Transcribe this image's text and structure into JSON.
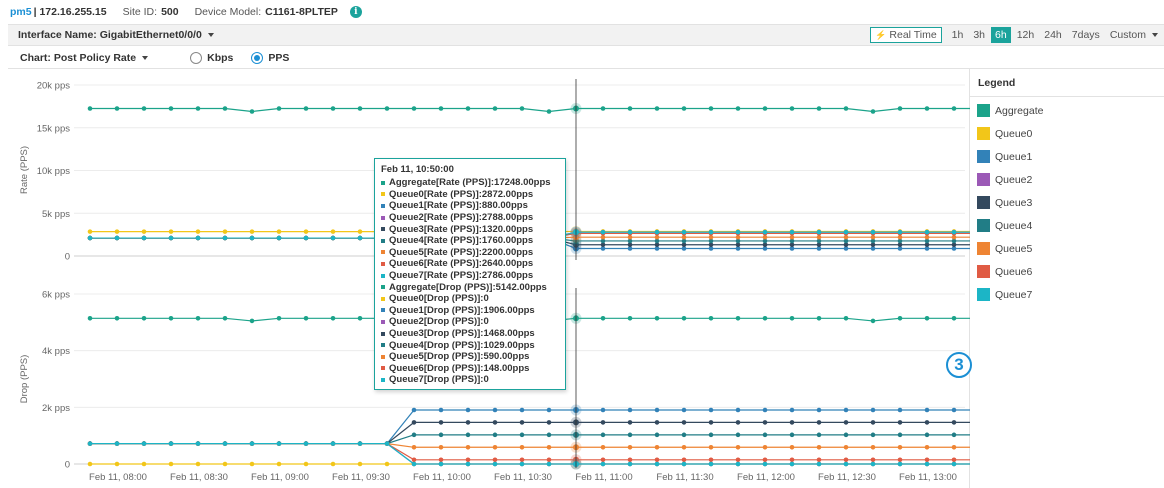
{
  "header": {
    "device_name": "pm5",
    "separator": "|",
    "ip": "172.16.255.15",
    "site_label": "Site ID:",
    "site_id": "500",
    "model_label": "Device Model:",
    "model": "C1161-8PLTEP",
    "info_icon": "info-icon",
    "info_glyph": "i"
  },
  "interface": {
    "label": "Interface Name: GigabitEthernet0/0/0"
  },
  "time_range": {
    "realtime_label": "Real Time",
    "options": [
      "1h",
      "3h",
      "6h",
      "12h",
      "24h",
      "7days"
    ],
    "active": "6h",
    "custom_label": "Custom"
  },
  "chart_selector": {
    "label": "Chart: Post Policy Rate",
    "unit_options": [
      "Kbps",
      "PPS"
    ],
    "selected_unit": "PPS"
  },
  "legend": {
    "title": "Legend",
    "items": [
      {
        "name": "Aggregate",
        "color": "#1ba38a"
      },
      {
        "name": "Queue0",
        "color": "#f2c619"
      },
      {
        "name": "Queue1",
        "color": "#3282b8"
      },
      {
        "name": "Queue2",
        "color": "#9b59b6"
      },
      {
        "name": "Queue3",
        "color": "#34495e"
      },
      {
        "name": "Queue4",
        "color": "#217d86"
      },
      {
        "name": "Queue5",
        "color": "#ee8433"
      },
      {
        "name": "Queue6",
        "color": "#e05b44"
      },
      {
        "name": "Queue7",
        "color": "#1cb5c6"
      }
    ]
  },
  "tooltip": {
    "time": "Feb 11, 10:50:00",
    "rows": [
      {
        "text": "Aggregate[Rate (PPS)]:17248.00pps",
        "color": "#1ba38a"
      },
      {
        "text": "Queue0[Rate (PPS)]:2872.00pps",
        "color": "#f2c619"
      },
      {
        "text": "Queue1[Rate (PPS)]:880.00pps",
        "color": "#3282b8"
      },
      {
        "text": "Queue2[Rate (PPS)]:2788.00pps",
        "color": "#9b59b6"
      },
      {
        "text": "Queue3[Rate (PPS)]:1320.00pps",
        "color": "#34495e"
      },
      {
        "text": "Queue4[Rate (PPS)]:1760.00pps",
        "color": "#217d86"
      },
      {
        "text": "Queue5[Rate (PPS)]:2200.00pps",
        "color": "#ee8433"
      },
      {
        "text": "Queue6[Rate (PPS)]:2640.00pps",
        "color": "#e05b44"
      },
      {
        "text": "Queue7[Rate (PPS)]:2786.00pps",
        "color": "#1cb5c6"
      },
      {
        "text": "Aggregate[Drop (PPS)]:5142.00pps",
        "color": "#1ba38a"
      },
      {
        "text": "Queue0[Drop (PPS)]:0",
        "color": "#f2c619"
      },
      {
        "text": "Queue1[Drop (PPS)]:1906.00pps",
        "color": "#3282b8"
      },
      {
        "text": "Queue2[Drop (PPS)]:0",
        "color": "#9b59b6"
      },
      {
        "text": "Queue3[Drop (PPS)]:1468.00pps",
        "color": "#34495e"
      },
      {
        "text": "Queue4[Drop (PPS)]:1029.00pps",
        "color": "#217d86"
      },
      {
        "text": "Queue5[Drop (PPS)]:590.00pps",
        "color": "#ee8433"
      },
      {
        "text": "Queue6[Drop (PPS)]:148.00pps",
        "color": "#e05b44"
      },
      {
        "text": "Queue7[Drop (PPS)]:0",
        "color": "#1cb5c6"
      }
    ]
  },
  "badge": {
    "text": "3"
  },
  "chart_data": [
    {
      "type": "line",
      "title": "",
      "ylabel": "Rate (PPS)",
      "xlabel": "",
      "ylim": [
        0,
        20000
      ],
      "y_ticks": [
        "0",
        "5k pps",
        "10k pps",
        "15k pps",
        "20k pps"
      ],
      "x_ticks": [
        "Feb 11, 08:00",
        "Feb 11, 08:30",
        "Feb 11, 09:00",
        "Feb 11, 09:30",
        "Feb 11, 10:00",
        "Feb 11, 10:30",
        "Feb 11, 11:00",
        "Feb 11, 11:30",
        "Feb 11, 12:00",
        "Feb 11, 12:30",
        "Feb 11, 13:00"
      ],
      "x_interval_minutes": 10,
      "crosshair_time": "Feb 11, 10:50",
      "grid": true,
      "series": [
        {
          "name": "Aggregate",
          "values": [
            17250,
            17250,
            17250,
            17250,
            17250,
            17250,
            16900,
            17250,
            17250,
            17250,
            17250,
            17250,
            17250,
            17250,
            17250,
            17250,
            17250,
            16900,
            17248,
            17250,
            17250,
            17250,
            17250,
            17250,
            17250,
            17250,
            17250,
            17250,
            17250,
            16900,
            17250,
            17250,
            17250,
            17250,
            17250
          ]
        },
        {
          "name": "Queue0",
          "values": [
            2850,
            2850,
            2850,
            2850,
            2850,
            2850,
            2850,
            2850,
            2850,
            2850,
            2850,
            2850,
            2850,
            2850,
            2850,
            2850,
            2850,
            2850,
            2872,
            2870,
            2870,
            2870,
            2870,
            2870,
            2870,
            2870,
            2870,
            2870,
            2870,
            2870,
            2870,
            2870,
            2870,
            2870,
            2870
          ]
        },
        {
          "name": "Queue1",
          "values": [
            2100,
            2100,
            2100,
            2100,
            2100,
            2100,
            2100,
            2100,
            2100,
            2100,
            2100,
            2100,
            2100,
            2100,
            2100,
            2100,
            2100,
            2100,
            880,
            880,
            880,
            880,
            880,
            880,
            880,
            880,
            880,
            880,
            880,
            880,
            880,
            880,
            880,
            880,
            880
          ]
        },
        {
          "name": "Queue2",
          "values": [
            2100,
            2100,
            2100,
            2100,
            2100,
            2100,
            2100,
            2100,
            2100,
            2100,
            2100,
            2100,
            2100,
            2100,
            2100,
            2100,
            2100,
            2100,
            2788,
            2788,
            2788,
            2788,
            2788,
            2788,
            2788,
            2788,
            2788,
            2788,
            2788,
            2788,
            2788,
            2788,
            2788,
            2788,
            2788
          ]
        },
        {
          "name": "Queue3",
          "values": [
            2100,
            2100,
            2100,
            2100,
            2100,
            2100,
            2100,
            2100,
            2100,
            2100,
            2100,
            2100,
            2100,
            2100,
            2100,
            2100,
            2100,
            2100,
            1320,
            1320,
            1320,
            1320,
            1320,
            1320,
            1320,
            1320,
            1320,
            1320,
            1320,
            1320,
            1320,
            1320,
            1320,
            1320,
            1320
          ]
        },
        {
          "name": "Queue4",
          "values": [
            2100,
            2100,
            2100,
            2100,
            2100,
            2100,
            2100,
            2100,
            2100,
            2100,
            2100,
            2100,
            2100,
            2100,
            2100,
            2100,
            2100,
            2100,
            1760,
            1760,
            1760,
            1760,
            1760,
            1760,
            1760,
            1760,
            1760,
            1760,
            1760,
            1760,
            1760,
            1760,
            1760,
            1760,
            1760
          ]
        },
        {
          "name": "Queue5",
          "values": [
            2100,
            2100,
            2100,
            2100,
            2100,
            2100,
            2100,
            2100,
            2100,
            2100,
            2100,
            2100,
            2100,
            2100,
            2100,
            2100,
            2100,
            2100,
            2200,
            2200,
            2200,
            2200,
            2200,
            2200,
            2200,
            2200,
            2200,
            2200,
            2200,
            2200,
            2200,
            2200,
            2200,
            2200,
            2200
          ]
        },
        {
          "name": "Queue6",
          "values": [
            2100,
            2100,
            2100,
            2100,
            2100,
            2100,
            2100,
            2100,
            2100,
            2100,
            2100,
            2100,
            2100,
            2100,
            2100,
            2100,
            2100,
            2100,
            2640,
            2640,
            2640,
            2640,
            2640,
            2640,
            2640,
            2640,
            2640,
            2640,
            2640,
            2640,
            2640,
            2640,
            2640,
            2640,
            2640
          ]
        },
        {
          "name": "Queue7",
          "values": [
            2100,
            2100,
            2100,
            2100,
            2100,
            2100,
            2100,
            2100,
            2100,
            2100,
            2100,
            2100,
            2100,
            2100,
            2100,
            2100,
            2100,
            2100,
            2786,
            2786,
            2786,
            2786,
            2786,
            2786,
            2786,
            2786,
            2786,
            2786,
            2786,
            2786,
            2786,
            2786,
            2786,
            2786,
            2786
          ]
        }
      ]
    },
    {
      "type": "line",
      "title": "",
      "ylabel": "Drop (PPS)",
      "xlabel": "",
      "ylim": [
        0,
        6000
      ],
      "y_ticks": [
        "0",
        "2k pps",
        "4k pps",
        "6k pps"
      ],
      "x_ticks": [
        "Feb 11, 08:00",
        "Feb 11, 08:30",
        "Feb 11, 09:00",
        "Feb 11, 09:30",
        "Feb 11, 10:00",
        "Feb 11, 10:30",
        "Feb 11, 11:00",
        "Feb 11, 11:30",
        "Feb 11, 12:00",
        "Feb 11, 12:30",
        "Feb 11, 13:00"
      ],
      "x_interval_minutes": 10,
      "crosshair_time": "Feb 11, 10:50",
      "grid": true,
      "series": [
        {
          "name": "Aggregate",
          "values": [
            5142,
            5142,
            5142,
            5142,
            5142,
            5142,
            5050,
            5142,
            5142,
            5142,
            5142,
            5142,
            5142,
            5142,
            5142,
            5142,
            5142,
            5050,
            5142,
            5142,
            5142,
            5142,
            5142,
            5142,
            5142,
            5142,
            5142,
            5142,
            5142,
            5050,
            5142,
            5142,
            5142,
            5142,
            5142
          ]
        },
        {
          "name": "Queue0",
          "values": [
            0,
            0,
            0,
            0,
            0,
            0,
            0,
            0,
            0,
            0,
            0,
            0,
            0,
            0,
            0,
            0,
            0,
            0,
            0,
            0,
            0,
            0,
            0,
            0,
            0,
            0,
            0,
            0,
            0,
            0,
            0,
            0,
            0,
            0,
            0
          ]
        },
        {
          "name": "Queue1",
          "values": [
            720,
            720,
            720,
            720,
            720,
            720,
            720,
            720,
            720,
            720,
            720,
            720,
            1906,
            1906,
            1906,
            1906,
            1906,
            1906,
            1906,
            1906,
            1906,
            1906,
            1906,
            1906,
            1906,
            1906,
            1906,
            1906,
            1906,
            1906,
            1906,
            1906,
            1906,
            1906,
            1906
          ]
        },
        {
          "name": "Queue2",
          "values": [
            720,
            720,
            720,
            720,
            720,
            720,
            720,
            720,
            720,
            720,
            720,
            720,
            0,
            0,
            0,
            0,
            0,
            0,
            0,
            0,
            0,
            0,
            0,
            0,
            0,
            0,
            0,
            0,
            0,
            0,
            0,
            0,
            0,
            0,
            0
          ]
        },
        {
          "name": "Queue3",
          "values": [
            720,
            720,
            720,
            720,
            720,
            720,
            720,
            720,
            720,
            720,
            720,
            720,
            1468,
            1468,
            1468,
            1468,
            1468,
            1468,
            1468,
            1468,
            1468,
            1468,
            1468,
            1468,
            1468,
            1468,
            1468,
            1468,
            1468,
            1468,
            1468,
            1468,
            1468,
            1468,
            1468
          ]
        },
        {
          "name": "Queue4",
          "values": [
            720,
            720,
            720,
            720,
            720,
            720,
            720,
            720,
            720,
            720,
            720,
            720,
            1029,
            1029,
            1029,
            1029,
            1029,
            1029,
            1029,
            1029,
            1029,
            1029,
            1029,
            1029,
            1029,
            1029,
            1029,
            1029,
            1029,
            1029,
            1029,
            1029,
            1029,
            1029,
            1029
          ]
        },
        {
          "name": "Queue5",
          "values": [
            720,
            720,
            720,
            720,
            720,
            720,
            720,
            720,
            720,
            720,
            720,
            720,
            590,
            590,
            590,
            590,
            590,
            590,
            590,
            590,
            590,
            590,
            590,
            590,
            590,
            590,
            590,
            590,
            590,
            590,
            590,
            590,
            590,
            590,
            590
          ]
        },
        {
          "name": "Queue6",
          "values": [
            720,
            720,
            720,
            720,
            720,
            720,
            720,
            720,
            720,
            720,
            720,
            720,
            148,
            148,
            148,
            148,
            148,
            148,
            148,
            148,
            148,
            148,
            148,
            148,
            148,
            148,
            148,
            148,
            148,
            148,
            148,
            148,
            148,
            148,
            148
          ]
        },
        {
          "name": "Queue7",
          "values": [
            720,
            720,
            720,
            720,
            720,
            720,
            720,
            720,
            720,
            720,
            720,
            720,
            0,
            0,
            0,
            0,
            0,
            0,
            0,
            0,
            0,
            0,
            0,
            0,
            0,
            0,
            0,
            0,
            0,
            0,
            0,
            0,
            0,
            0,
            0
          ]
        }
      ]
    }
  ]
}
